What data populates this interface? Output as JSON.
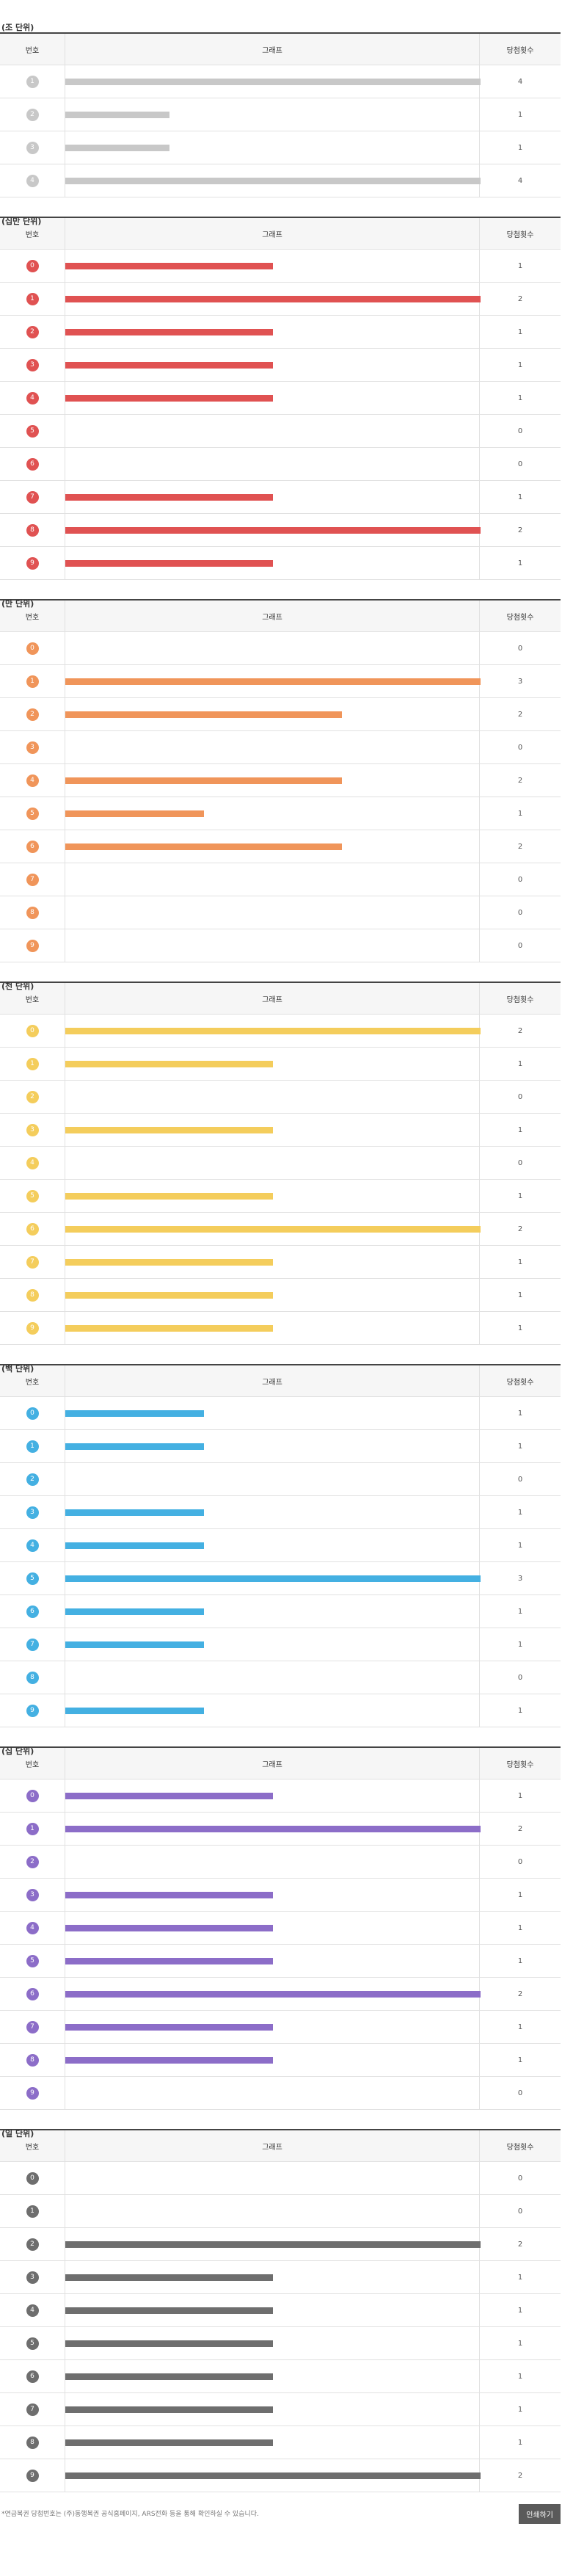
{
  "table_headers": {
    "number": "번호",
    "graph": "그래프",
    "count": "당첨횟수"
  },
  "max_count": 3,
  "sections": [
    {
      "title": "(조 단위)",
      "color": "#c8c8c8",
      "rows": [
        {
          "n": "1",
          "c": 4
        },
        {
          "n": "2",
          "c": 1
        },
        {
          "n": "3",
          "c": 1
        },
        {
          "n": "4",
          "c": 4
        }
      ],
      "scale": 4
    },
    {
      "title": "(십만 단위)",
      "color": "#e05252",
      "rows": [
        {
          "n": "0",
          "c": 1
        },
        {
          "n": "1",
          "c": 2
        },
        {
          "n": "2",
          "c": 1
        },
        {
          "n": "3",
          "c": 1
        },
        {
          "n": "4",
          "c": 1
        },
        {
          "n": "5",
          "c": 0
        },
        {
          "n": "6",
          "c": 0
        },
        {
          "n": "7",
          "c": 1
        },
        {
          "n": "8",
          "c": 2
        },
        {
          "n": "9",
          "c": 1
        }
      ],
      "scale": 2
    },
    {
      "title": "(만 단위)",
      "color": "#f0955a",
      "rows": [
        {
          "n": "0",
          "c": 0
        },
        {
          "n": "1",
          "c": 3
        },
        {
          "n": "2",
          "c": 2
        },
        {
          "n": "3",
          "c": 0
        },
        {
          "n": "4",
          "c": 2
        },
        {
          "n": "5",
          "c": 1
        },
        {
          "n": "6",
          "c": 2
        },
        {
          "n": "7",
          "c": 0
        },
        {
          "n": "8",
          "c": 0
        },
        {
          "n": "9",
          "c": 0
        }
      ],
      "scale": 3
    },
    {
      "title": "(천 단위)",
      "color": "#f4cd5c",
      "rows": [
        {
          "n": "0",
          "c": 2
        },
        {
          "n": "1",
          "c": 1
        },
        {
          "n": "2",
          "c": 0
        },
        {
          "n": "3",
          "c": 1
        },
        {
          "n": "4",
          "c": 0
        },
        {
          "n": "5",
          "c": 1
        },
        {
          "n": "6",
          "c": 2
        },
        {
          "n": "7",
          "c": 1
        },
        {
          "n": "8",
          "c": 1
        },
        {
          "n": "9",
          "c": 1
        }
      ],
      "scale": 2
    },
    {
      "title": "(백 단위)",
      "color": "#44b0e2",
      "rows": [
        {
          "n": "0",
          "c": 1
        },
        {
          "n": "1",
          "c": 1
        },
        {
          "n": "2",
          "c": 0
        },
        {
          "n": "3",
          "c": 1
        },
        {
          "n": "4",
          "c": 1
        },
        {
          "n": "5",
          "c": 3
        },
        {
          "n": "6",
          "c": 1
        },
        {
          "n": "7",
          "c": 1
        },
        {
          "n": "8",
          "c": 0
        },
        {
          "n": "9",
          "c": 1
        }
      ],
      "scale": 3
    },
    {
      "title": "(십 단위)",
      "color": "#8c6dc8",
      "rows": [
        {
          "n": "0",
          "c": 1
        },
        {
          "n": "1",
          "c": 2
        },
        {
          "n": "2",
          "c": 0
        },
        {
          "n": "3",
          "c": 1
        },
        {
          "n": "4",
          "c": 1
        },
        {
          "n": "5",
          "c": 1
        },
        {
          "n": "6",
          "c": 2
        },
        {
          "n": "7",
          "c": 1
        },
        {
          "n": "8",
          "c": 1
        },
        {
          "n": "9",
          "c": 0
        }
      ],
      "scale": 2
    },
    {
      "title": "(일 단위)",
      "color": "#6e6e6e",
      "rows": [
        {
          "n": "0",
          "c": 0
        },
        {
          "n": "1",
          "c": 0
        },
        {
          "n": "2",
          "c": 2
        },
        {
          "n": "3",
          "c": 1
        },
        {
          "n": "4",
          "c": 1
        },
        {
          "n": "5",
          "c": 1
        },
        {
          "n": "6",
          "c": 1
        },
        {
          "n": "7",
          "c": 1
        },
        {
          "n": "8",
          "c": 1
        },
        {
          "n": "9",
          "c": 2
        }
      ],
      "scale": 2
    }
  ],
  "footer": {
    "note": "*연금복권 당첨번호는 (주)동행복권 공식홈페이지, ARS전화 등을 통해 확인하실 수 있습니다.",
    "print_label": "인쇄하기"
  }
}
